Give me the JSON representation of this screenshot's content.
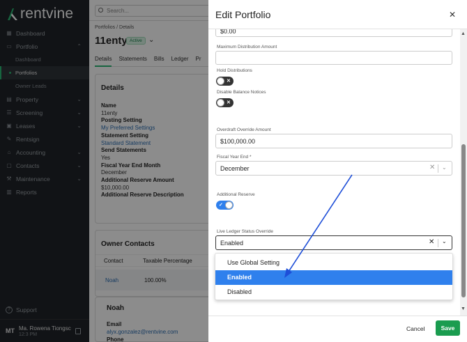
{
  "app": {
    "logo_text": "rentvine"
  },
  "sidebar": {
    "items": [
      {
        "label": "Dashboard",
        "icon": "grid-icon"
      },
      {
        "label": "Portfolio",
        "icon": "briefcase-icon",
        "expanded": true
      },
      {
        "label": "Property",
        "icon": "building-icon"
      },
      {
        "label": "Screening",
        "icon": "list-icon"
      },
      {
        "label": "Leases",
        "icon": "document-icon"
      },
      {
        "label": "Rentsign",
        "icon": "signature-icon"
      },
      {
        "label": "Accounting",
        "icon": "bank-icon"
      },
      {
        "label": "Contacts",
        "icon": "contacts-icon"
      },
      {
        "label": "Maintenance",
        "icon": "wrench-icon"
      },
      {
        "label": "Reports",
        "icon": "chart-icon"
      }
    ],
    "portfolio_sub": [
      "Dashboard",
      "Portfolios",
      "Owner Leads"
    ],
    "support_label": "Support",
    "user": {
      "initials": "MT",
      "name": "Ma. Rowena Tiongsc",
      "time": "12:3 PM"
    }
  },
  "main": {
    "search_placeholder": "Search...",
    "breadcrumb": "Portfolios  /  Details",
    "title": "11enty",
    "status_badge": "Active",
    "tabs": [
      "Details",
      "Statements",
      "Bills",
      "Ledger",
      "Pr"
    ],
    "details": {
      "heading": "Details",
      "rows": [
        {
          "k": "Name"
        },
        {
          "v": "11enty"
        },
        {
          "k": "Posting Setting"
        },
        {
          "link": "My Preferred Settings"
        },
        {
          "k": "Statement Setting"
        },
        {
          "link": "Standard Statement"
        },
        {
          "k": "Send Statements"
        },
        {
          "v": "Yes"
        },
        {
          "k": "Fiscal Year End Month"
        },
        {
          "v": "December"
        },
        {
          "k": "Additional Reserve Amount"
        },
        {
          "v": "$10,000.00"
        },
        {
          "k": "Additional Reserve Description"
        }
      ]
    },
    "owner_contacts": {
      "heading": "Owner Contacts",
      "col_contact": "Contact",
      "col_taxable": "Taxable Percentage",
      "row_name": "Noah",
      "row_pct": "100.00%"
    },
    "noah_card": {
      "heading": "Noah",
      "email_label": "Email",
      "email": "alyx.gonzalez@rentvine.com",
      "phone_label": "Phone"
    }
  },
  "modal": {
    "title": "Edit Portfolio",
    "top_value": "$0.00",
    "max_distribution_label": "Maximum Distribution Amount",
    "max_distribution_value": "",
    "hold_distributions_label": "Hold Distributions",
    "disable_balance_label": "Disable Balance Notices",
    "overdraft_label": "Overdraft Override Amount",
    "overdraft_value": "$100,000.00",
    "fiscal_label": "Fiscal Year End *",
    "fiscal_value": "December",
    "additional_reserve_label": "Additional Reserve",
    "live_ledger_label": "Live Ledger Status Override",
    "live_ledger_value": "Enabled",
    "options": [
      "Use Global Setting",
      "Enabled",
      "Disabled"
    ],
    "selected_option": "Enabled",
    "cancel_label": "Cancel",
    "save_label": "Save"
  },
  "colors": {
    "accent": "#2bb673",
    "primary_blue": "#2f80ed",
    "save_green": "#1a9c4f"
  }
}
